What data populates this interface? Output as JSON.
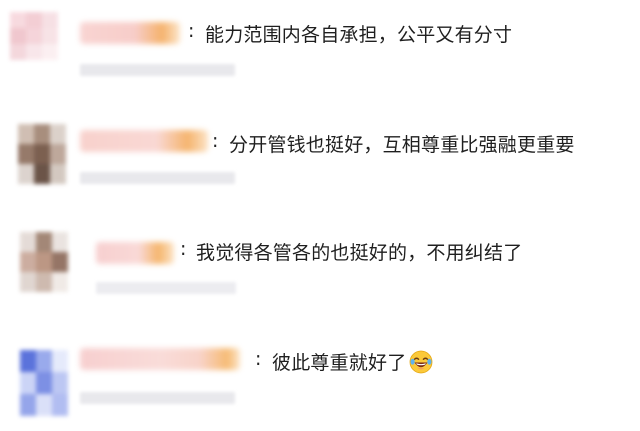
{
  "comments": [
    {
      "text": "能力范围内各自承担，公平又有分寸"
    },
    {
      "text": "分开管钱也挺好，互相尊重比强融更重要"
    },
    {
      "text": "我觉得各管各的也挺好的，不用纠结了"
    },
    {
      "text": "彼此尊重就好了",
      "emoji": "laughing-tears-emoji"
    }
  ],
  "colon": ":",
  "colors": {
    "text": "#1f1f1f",
    "name_pink": "#f6c0c0",
    "name_orange": "#f5b870",
    "meta_gray": "#e8e8ec"
  }
}
